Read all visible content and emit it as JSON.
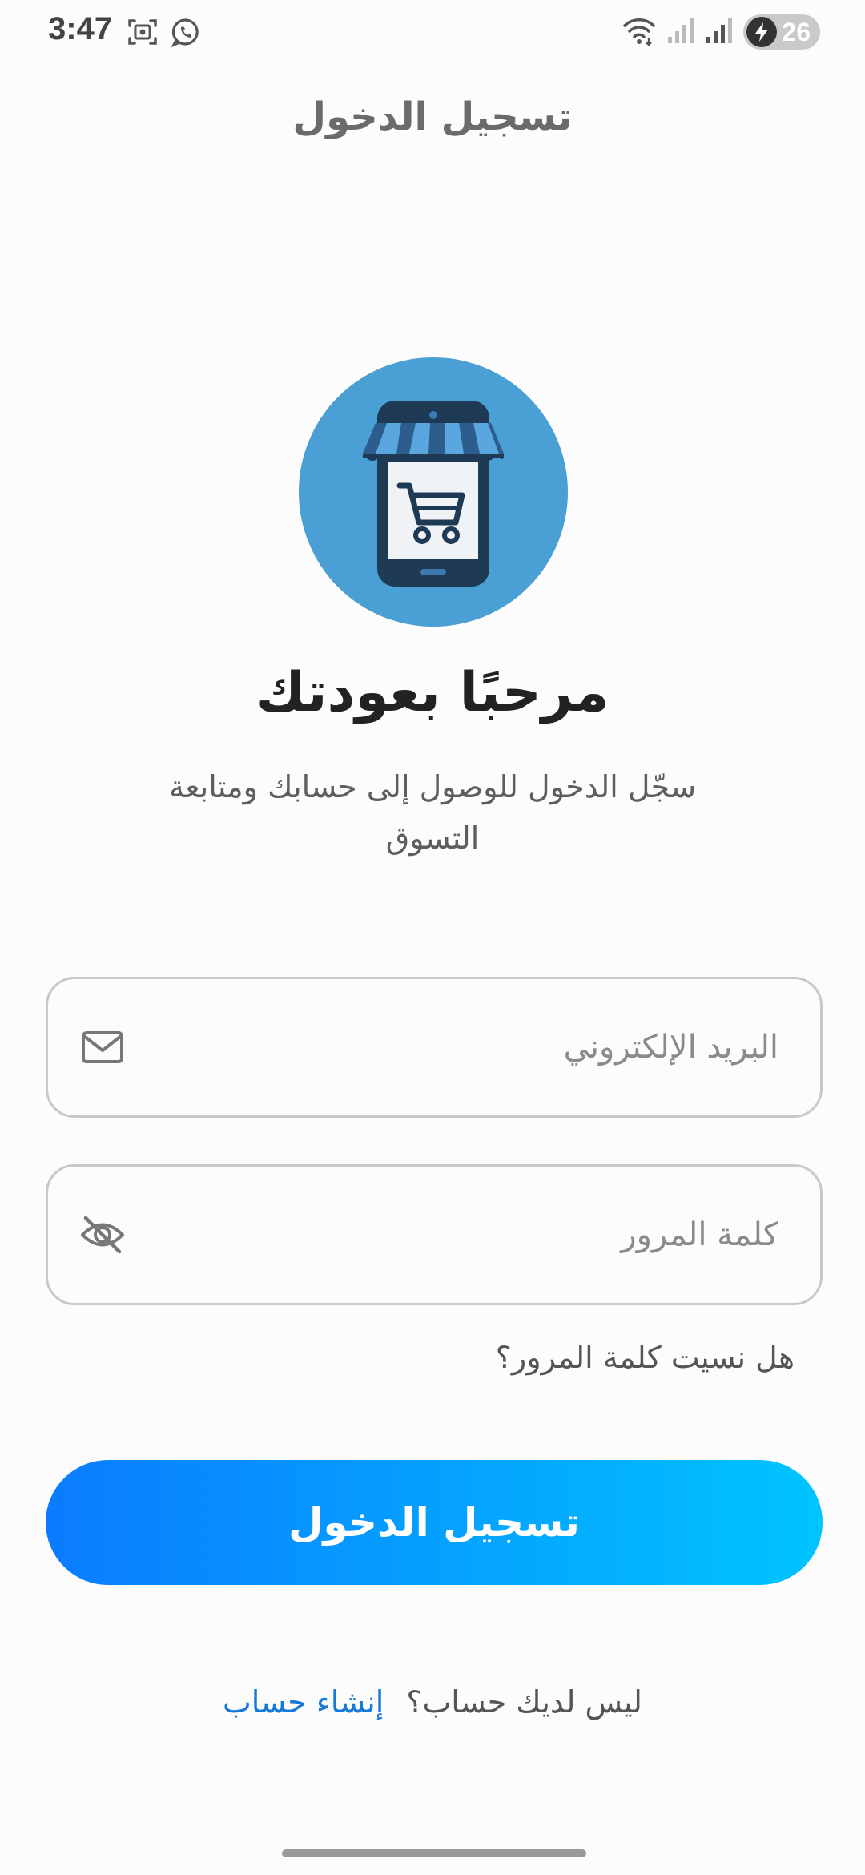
{
  "status_bar": {
    "time": "3:47",
    "battery_level": "26",
    "icons": [
      "screenshot-icon",
      "whatsapp-icon",
      "wifi-icon",
      "signal-icon",
      "signal-icon",
      "charging-icon"
    ]
  },
  "header": {
    "title": "تسجيل الدخول"
  },
  "logo": {
    "icon": "shopping-store-phone-icon",
    "circle_color": "#4a9fd4"
  },
  "welcome": {
    "heading": "مرحبًا بعودتك",
    "subtitle": "سجّل الدخول للوصول إلى حسابك ومتابعة التسوق"
  },
  "form": {
    "email": {
      "value": "",
      "placeholder": "البريد الإلكتروني",
      "icon": "mail-icon"
    },
    "password": {
      "value": "",
      "placeholder": "كلمة المرور",
      "icon": "eye-off-icon"
    },
    "forgot_password": "هل نسيت كلمة المرور؟",
    "submit_label": "تسجيل الدخول"
  },
  "signup": {
    "prompt": "ليس لديك حساب؟",
    "link": "إنشاء حساب"
  },
  "colors": {
    "accent_start": "#0a7cff",
    "accent_end": "#00c4ff",
    "link": "#1479d8"
  }
}
